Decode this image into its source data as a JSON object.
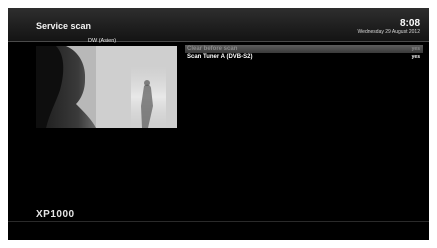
{
  "header": {
    "title": "Service scan",
    "clock": "8:08",
    "date": "Wednesday 29 August 2012"
  },
  "preview": {
    "channel": "DW (Asien)"
  },
  "scan_options": [
    {
      "label": "Clear before scan",
      "value": "yes",
      "selected": true
    },
    {
      "label": "Scan Tuner A (DVB-S2)",
      "value": "yes",
      "selected": false
    }
  ],
  "footer": {
    "model": "XP1000"
  },
  "colors": {
    "screen_bg": "#000000",
    "header_bg": "#1f1f1f",
    "selection_bg": "#4a4a4a",
    "text": "#ffffff"
  }
}
